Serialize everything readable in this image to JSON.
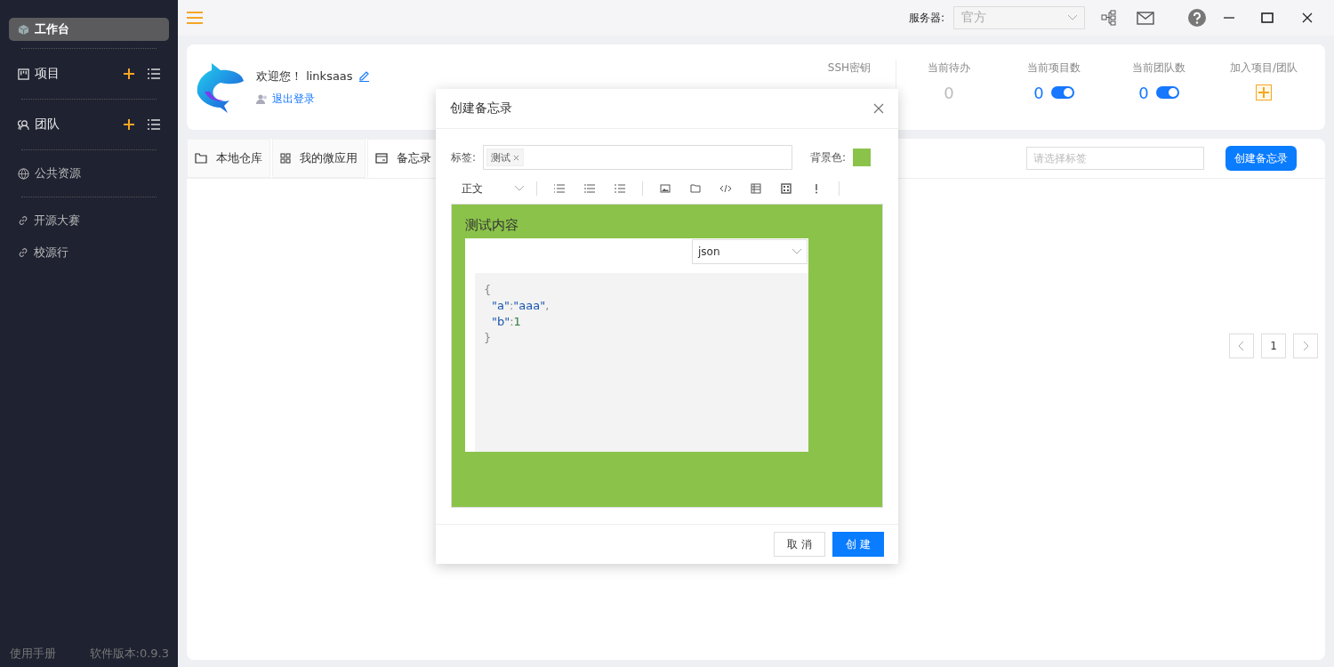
{
  "sidebar": {
    "items": [
      {
        "label": "工作台",
        "kind": "workspace",
        "selected": true
      },
      {
        "label": "项目",
        "kind": "project",
        "selected": false
      },
      {
        "label": "团队",
        "kind": "team",
        "selected": false
      },
      {
        "label": "公共资源",
        "kind": "resource",
        "selected": false
      },
      {
        "label": "开源大赛",
        "kind": "link",
        "selected": false
      },
      {
        "label": "校源行",
        "kind": "link",
        "selected": false
      }
    ],
    "manual": "使用手册",
    "version": "软件版本:0.9.3"
  },
  "top_bar": {
    "server_label": "服务器:",
    "server_value": "官方"
  },
  "profile": {
    "greeting": "欢迎您！",
    "username": "linksaas",
    "logout": "退出登录",
    "stats": [
      {
        "label": "SSH密钥",
        "kind": "label"
      },
      {
        "label": "当前待办",
        "kind": "count",
        "value": "0"
      },
      {
        "label": "当前项目数",
        "kind": "toggle",
        "value": "0",
        "on": true
      },
      {
        "label": "当前团队数",
        "kind": "toggle",
        "value": "0",
        "on": true
      },
      {
        "label": "加入项目/团队",
        "kind": "add"
      }
    ]
  },
  "tabs": [
    {
      "label": "本地仓库",
      "selected": false
    },
    {
      "label": "我的微应用",
      "selected": false
    },
    {
      "label": "备忘录",
      "selected": true
    }
  ],
  "memo_toolbar": {
    "tag_placeholder": "请选择标签",
    "create_button": "创建备忘录"
  },
  "pagination": {
    "page": "1"
  },
  "dialog": {
    "title": "创建备忘录",
    "tags_label": "标签:",
    "tags": [
      {
        "label": "测试"
      }
    ],
    "bg_label": "背景色:",
    "heading_select": "正文",
    "editor": {
      "heading": "测试内容",
      "code_language": "json",
      "lines": [
        {
          "indented": false,
          "tokens": [
            {
              "text": "{",
              "kind": "punct"
            }
          ]
        },
        {
          "indented": true,
          "tokens": [
            {
              "text": "\"a\"",
              "kind": "key"
            },
            {
              "text": ":",
              "kind": "punct"
            },
            {
              "text": "\"aaa\"",
              "kind": "string"
            },
            {
              "text": ",",
              "kind": "punct"
            }
          ]
        },
        {
          "indented": true,
          "tokens": [
            {
              "text": "\"b\"",
              "kind": "key"
            },
            {
              "text": ":",
              "kind": "punct"
            },
            {
              "text": "1",
              "kind": "number"
            }
          ]
        },
        {
          "indented": false,
          "tokens": [
            {
              "text": "}",
              "kind": "punct"
            }
          ]
        }
      ]
    },
    "cancel": "取 消",
    "ok": "创 建"
  }
}
